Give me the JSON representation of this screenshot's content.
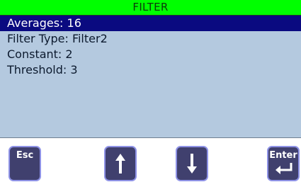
{
  "screen": {
    "title": "FILTER",
    "items": [
      {
        "label": "Averages: 16",
        "selected": true
      },
      {
        "label": "Filter Type: Filter2",
        "selected": false
      },
      {
        "label": "Constant: 2",
        "selected": false
      },
      {
        "label": "Threshold: 3",
        "selected": false
      }
    ]
  },
  "keys": {
    "esc_label": "Esc",
    "up_icon": "arrow-up-icon",
    "down_icon": "arrow-down-icon",
    "enter_label": "Enter",
    "enter_icon": "enter-return-icon"
  },
  "colors": {
    "title_bg": "#00ff00",
    "screen_bg": "#b4c9df",
    "selected_bg": "#0a0a80",
    "key_bg": "#40406e",
    "key_border": "#8e92e6"
  }
}
